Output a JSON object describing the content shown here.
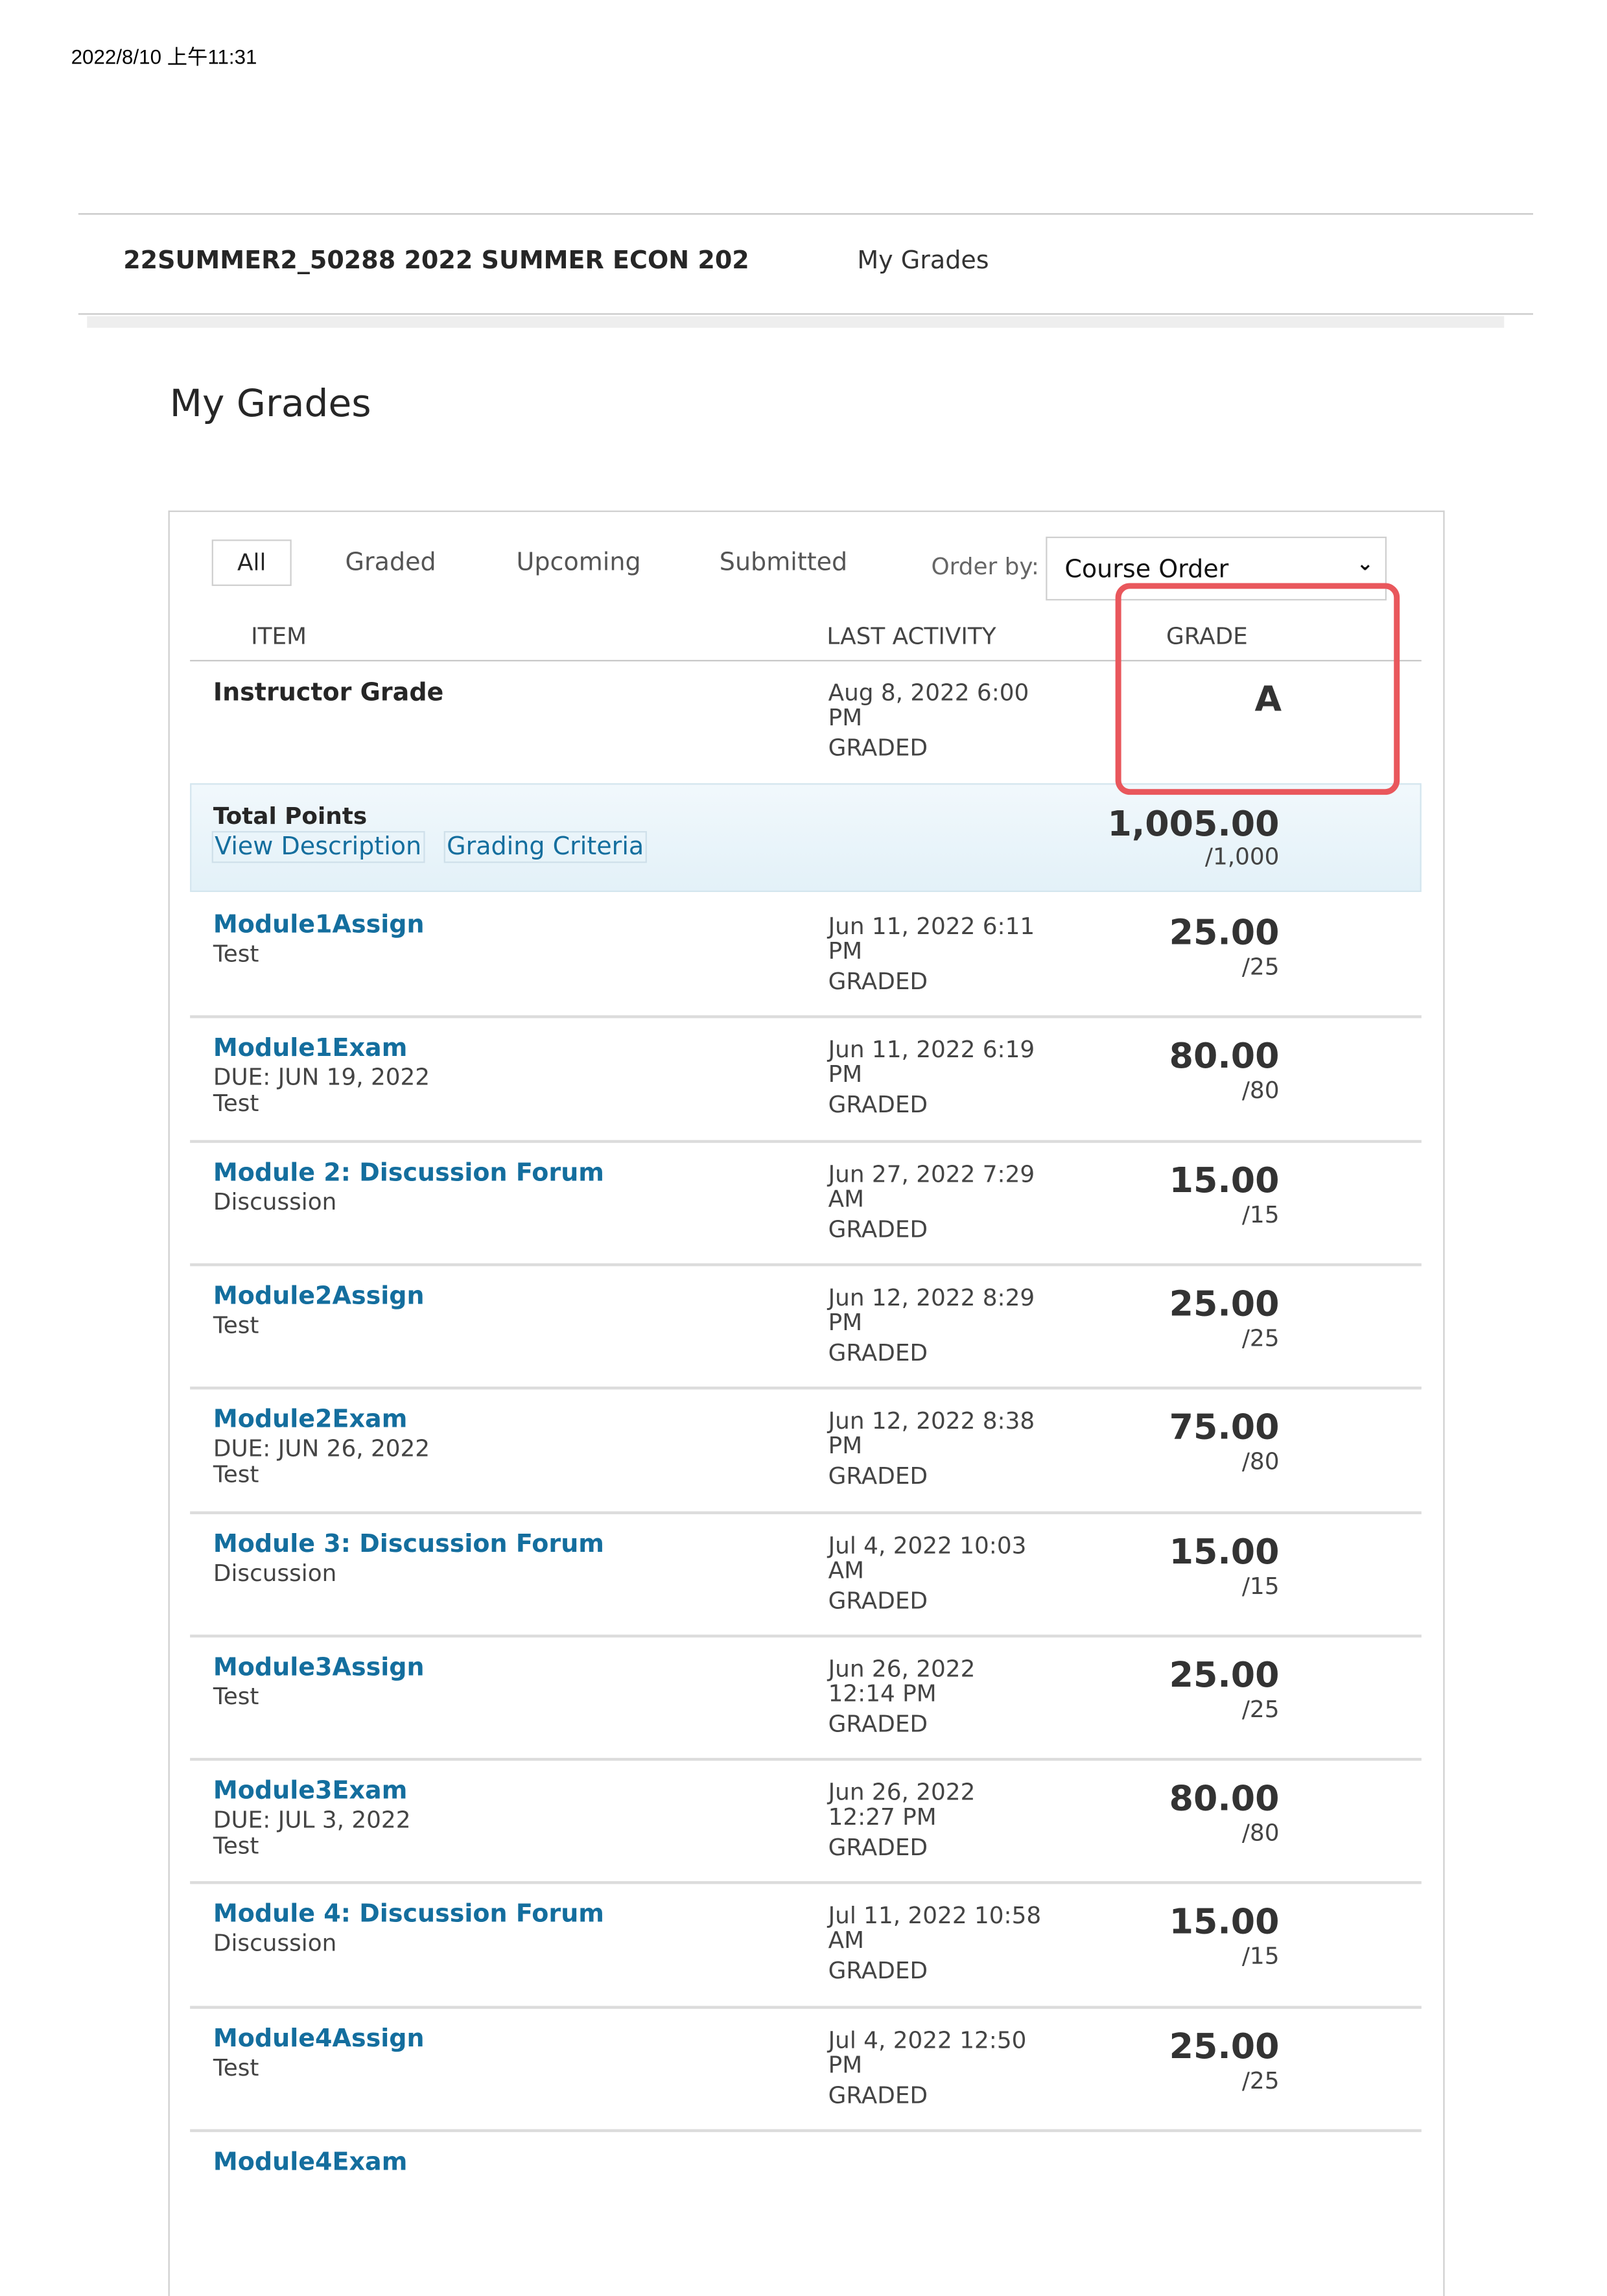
{
  "print_timestamp": "2022/8/10 上午11:31",
  "header": {
    "course_title": "22SUMMER2_50288 2022 SUMMER ECON 202",
    "breadcrumb": "My Grades"
  },
  "page_title": "My Grades",
  "tabs": [
    "All",
    "Graded",
    "Upcoming",
    "Submitted"
  ],
  "active_tab": "All",
  "order_by": {
    "label": "Order by:",
    "selected": "Course Order"
  },
  "columns": {
    "item": "ITEM",
    "last_activity": "LAST ACTIVITY",
    "grade": "GRADE"
  },
  "highlight_color": "#e9575c",
  "link_color": "#146e9e",
  "instructor_grade": {
    "title": "Instructor Grade",
    "activity": [
      "Aug 8, 2022 6:00",
      "PM"
    ],
    "status": "GRADED",
    "grade": "A"
  },
  "total_points": {
    "title": "Total Points",
    "view_description": "View Description",
    "grading_criteria": "Grading Criteria",
    "score": "1,005.00",
    "out_of": "/1,000"
  },
  "rows": [
    {
      "title": "Module1Assign",
      "sub": [
        "Test"
      ],
      "activity": [
        "Jun 11, 2022 6:11",
        "PM"
      ],
      "status": "GRADED",
      "score": "25.00",
      "out_of": "/25"
    },
    {
      "title": "Module1Exam",
      "sub": [
        "DUE: JUN 19, 2022",
        "Test"
      ],
      "activity": [
        "Jun 11, 2022 6:19",
        "PM"
      ],
      "status": "GRADED",
      "score": "80.00",
      "out_of": "/80"
    },
    {
      "title": "Module 2: Discussion Forum",
      "sub": [
        "Discussion"
      ],
      "activity": [
        "Jun 27, 2022 7:29",
        "AM"
      ],
      "status": "GRADED",
      "score": "15.00",
      "out_of": "/15"
    },
    {
      "title": "Module2Assign",
      "sub": [
        "Test"
      ],
      "activity": [
        "Jun 12, 2022 8:29",
        "PM"
      ],
      "status": "GRADED",
      "score": "25.00",
      "out_of": "/25"
    },
    {
      "title": "Module2Exam",
      "sub": [
        "DUE: JUN 26, 2022",
        "Test"
      ],
      "activity": [
        "Jun 12, 2022 8:38",
        "PM"
      ],
      "status": "GRADED",
      "score": "75.00",
      "out_of": "/80"
    },
    {
      "title": "Module 3: Discussion Forum",
      "sub": [
        "Discussion"
      ],
      "activity": [
        "Jul 4, 2022 10:03",
        "AM"
      ],
      "status": "GRADED",
      "score": "15.00",
      "out_of": "/15"
    },
    {
      "title": "Module3Assign",
      "sub": [
        "Test"
      ],
      "activity": [
        "Jun 26, 2022",
        "12:14 PM"
      ],
      "status": "GRADED",
      "score": "25.00",
      "out_of": "/25"
    },
    {
      "title": "Module3Exam",
      "sub": [
        "DUE: JUL 3, 2022",
        "Test"
      ],
      "activity": [
        "Jun 26, 2022",
        "12:27 PM"
      ],
      "status": "GRADED",
      "score": "80.00",
      "out_of": "/80"
    },
    {
      "title": "Module 4: Discussion Forum",
      "sub": [
        "Discussion"
      ],
      "activity": [
        "Jul 11, 2022 10:58",
        "AM"
      ],
      "status": "GRADED",
      "score": "15.00",
      "out_of": "/15"
    },
    {
      "title": "Module4Assign",
      "sub": [
        "Test"
      ],
      "activity": [
        "Jul 4, 2022 12:50",
        "PM"
      ],
      "status": "GRADED",
      "score": "25.00",
      "out_of": "/25"
    },
    {
      "title": "Module4Exam",
      "sub": [],
      "activity": [],
      "status": "",
      "score": "",
      "out_of": ""
    }
  ]
}
